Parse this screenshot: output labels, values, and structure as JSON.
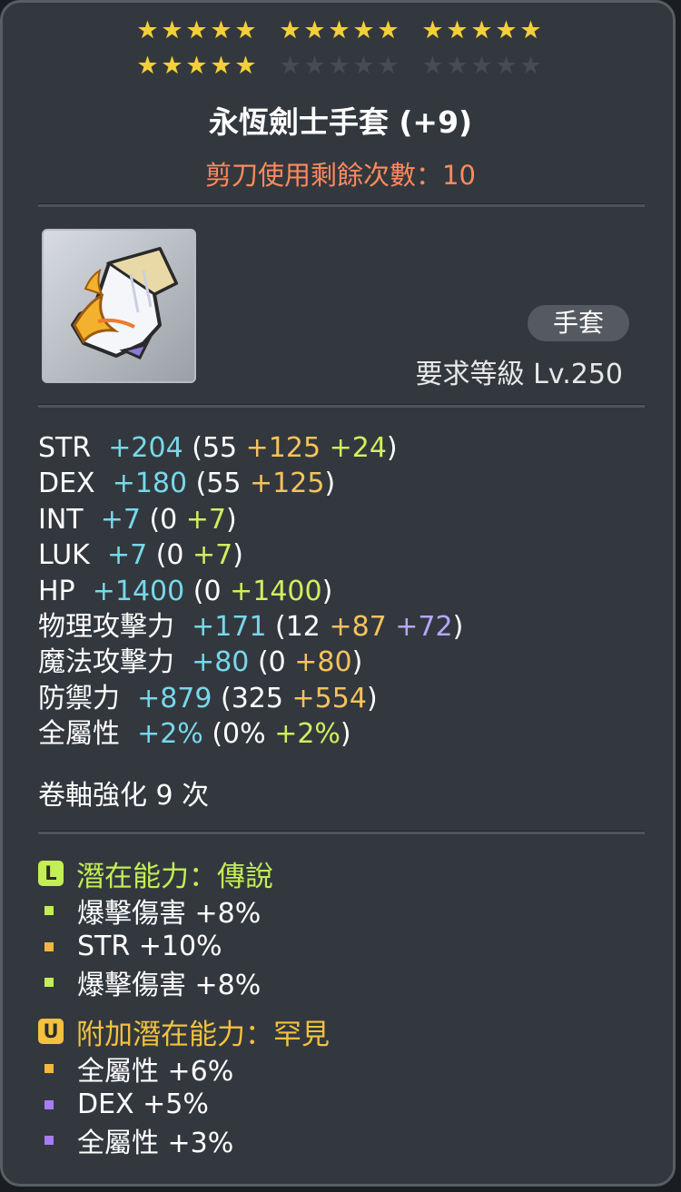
{
  "stars": {
    "row1": [
      [
        true,
        true,
        true,
        true,
        true
      ],
      [
        true,
        true,
        true,
        true,
        true
      ],
      [
        true,
        true,
        true,
        true,
        true
      ]
    ],
    "row2": [
      [
        true,
        true,
        true,
        true,
        true
      ],
      [
        false,
        false,
        false,
        false,
        false
      ],
      [
        false,
        false,
        false,
        false,
        false
      ]
    ]
  },
  "item": {
    "name": "永恆劍士手套 (+9)",
    "scissors": "剪刀使用剩餘次數：10",
    "type": "手套",
    "req_label": "要求等級",
    "req_level": "Lv.250",
    "icon": "glove-icon"
  },
  "stats": [
    {
      "label": "STR",
      "total": "+204",
      "parts": [
        {
          "t": "(55 ",
          "c": "white"
        },
        {
          "t": "+125 ",
          "c": "orange"
        },
        {
          "t": "+24",
          "c": "green"
        },
        {
          "t": ")",
          "c": "white"
        }
      ]
    },
    {
      "label": "DEX",
      "total": "+180",
      "parts": [
        {
          "t": "(55 ",
          "c": "white"
        },
        {
          "t": "+125",
          "c": "orange"
        },
        {
          "t": ")",
          "c": "white"
        }
      ]
    },
    {
      "label": "INT",
      "total": "+7",
      "parts": [
        {
          "t": "(0 ",
          "c": "white"
        },
        {
          "t": "+7",
          "c": "green"
        },
        {
          "t": ")",
          "c": "white"
        }
      ]
    },
    {
      "label": "LUK",
      "total": "+7",
      "parts": [
        {
          "t": "(0 ",
          "c": "white"
        },
        {
          "t": "+7",
          "c": "green"
        },
        {
          "t": ")",
          "c": "white"
        }
      ]
    },
    {
      "label": "HP",
      "total": "+1400",
      "parts": [
        {
          "t": "(0 ",
          "c": "white"
        },
        {
          "t": "+1400",
          "c": "green"
        },
        {
          "t": ")",
          "c": "white"
        }
      ]
    },
    {
      "label": "物理攻擊力",
      "total": "+171",
      "parts": [
        {
          "t": "(12 ",
          "c": "white"
        },
        {
          "t": "+87 ",
          "c": "orange"
        },
        {
          "t": "+72",
          "c": "purple"
        },
        {
          "t": ")",
          "c": "white"
        }
      ]
    },
    {
      "label": "魔法攻擊力",
      "total": "+80",
      "parts": [
        {
          "t": "(0 ",
          "c": "white"
        },
        {
          "t": "+80",
          "c": "orange"
        },
        {
          "t": ")",
          "c": "white"
        }
      ]
    },
    {
      "label": "防禦力",
      "total": "+879",
      "parts": [
        {
          "t": "(325 ",
          "c": "white"
        },
        {
          "t": "+554",
          "c": "orange"
        },
        {
          "t": ")",
          "c": "white"
        }
      ]
    },
    {
      "label": "全屬性",
      "total": "+2%",
      "parts": [
        {
          "t": "(0% ",
          "c": "white"
        },
        {
          "t": "+2%",
          "c": "green"
        },
        {
          "t": ")",
          "c": "white"
        }
      ]
    }
  ],
  "scroll_text": "卷軸強化 9 次",
  "potential": {
    "icon_letter": "L",
    "header": "潛在能力：傳說",
    "color": "#c3ee54",
    "lines": [
      {
        "text": "爆擊傷害 +8%",
        "bullet": "#c3ee54"
      },
      {
        "text": "STR +10%",
        "bullet": "#f5b63c"
      },
      {
        "text": "爆擊傷害 +8%",
        "bullet": "#c3ee54"
      }
    ]
  },
  "additional": {
    "icon_letter": "U",
    "header": "附加潛在能力：罕見",
    "color": "#f3c13f",
    "lines": [
      {
        "text": "全屬性 +6%",
        "bullet": "#f5b63c"
      },
      {
        "text": "DEX +5%",
        "bullet": "#a77cf2"
      },
      {
        "text": "全屬性 +3%",
        "bullet": "#a77cf2"
      }
    ]
  }
}
